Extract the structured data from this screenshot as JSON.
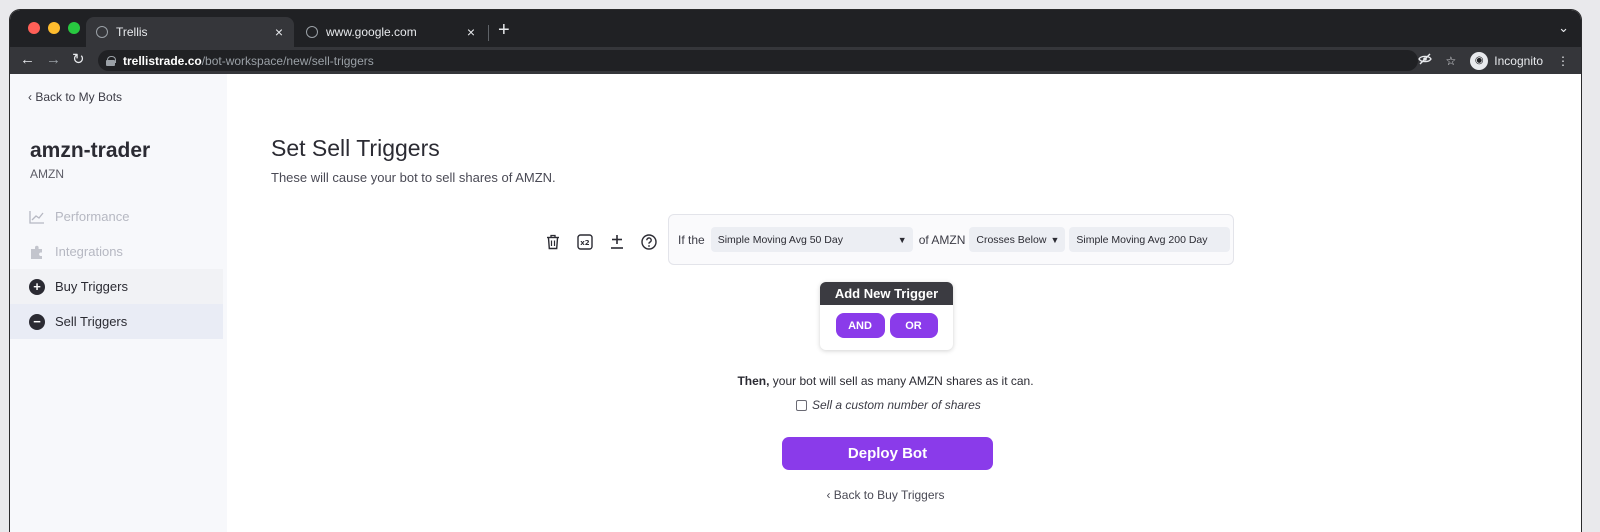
{
  "browser": {
    "tabs": [
      {
        "title": "Trellis",
        "close": "×"
      },
      {
        "title": "www.google.com",
        "close": "×"
      }
    ],
    "new_tab": "+",
    "tab_menu": "⌄",
    "url_host": "trellistrade.co",
    "url_path": "/bot-workspace/new/sell-triggers",
    "profile_label": "Incognito",
    "traffic_light_colors": [
      "#ff5f57",
      "#febc2e",
      "#28c840"
    ]
  },
  "sidebar": {
    "back_label": "‹ Back to My Bots",
    "bot_name": "amzn-trader",
    "ticker": "AMZN",
    "items": [
      {
        "label": "Performance",
        "icon": "chart-line-icon",
        "state": "disabled"
      },
      {
        "label": "Integrations",
        "icon": "puzzle-icon",
        "state": "disabled"
      },
      {
        "label": "Buy Triggers",
        "icon": "plus-circle-icon",
        "state": "normal"
      },
      {
        "label": "Sell Triggers",
        "icon": "minus-circle-icon",
        "state": "active"
      }
    ]
  },
  "main": {
    "title": "Set Sell Triggers",
    "subtitle": "These will cause your bot to sell shares of AMZN.",
    "trigger": {
      "if_label": "If the",
      "indicator_value": "Simple Moving Avg 50 Day",
      "of_label": "of AMZN",
      "condition_value": "Crosses Below",
      "target_value": "Simple Moving Avg 200 Day"
    },
    "add_trigger": {
      "heading": "Add New Trigger",
      "and_label": "AND",
      "or_label": "OR"
    },
    "then_bold": "Then,",
    "then_rest": " your bot will sell as many AMZN shares as it can.",
    "custom_label": "Sell a custom number of shares",
    "deploy_label": "Deploy Bot",
    "back_buy_label": "‹ Back to Buy Triggers"
  },
  "colors": {
    "accent": "#8a3bea",
    "sidebar_bg": "#f7f8fb"
  }
}
